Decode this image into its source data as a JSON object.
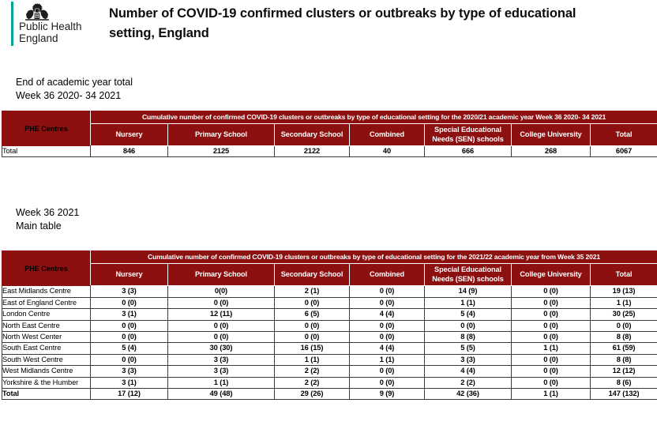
{
  "brand": {
    "name_line1": "Public Health",
    "name_line2": "England",
    "crest_icon": "royal-coat-of-arms-icon",
    "accent_color": "#00A499"
  },
  "page": {
    "title_line1": "Number of COVID-19 confirmed clusters or outbreaks by type of educational",
    "title_line2": "setting, England",
    "table_header_color": "#8C1010"
  },
  "section_one": {
    "caption_line1": "End of academic year total",
    "caption_line2": "Week 36 2020- 34 2021",
    "banner": "Cumulative number of confirmed COVID-19 clusters or outbreaks by type of educational setting for the 2020/21 academic year Week 36 2020- 34 2021",
    "row_header": "PHE Centres",
    "columns": [
      "Nursery",
      "Primary School",
      "Secondary School",
      "Combined",
      "Special Educational Needs (SEN) schools",
      "College University",
      "Total"
    ],
    "columns_display": [
      {
        "line1": "Nursery",
        "line2": ""
      },
      {
        "line1": "Primary School",
        "line2": ""
      },
      {
        "line1": "Secondary School",
        "line2": ""
      },
      {
        "line1": "Combined",
        "line2": ""
      },
      {
        "line1": "Special Educational",
        "line2": "Needs (SEN) schools"
      },
      {
        "line1": "College University",
        "line2": ""
      },
      {
        "line1": "Total",
        "line2": ""
      }
    ],
    "rows": [
      {
        "label": "Total",
        "values": [
          "846",
          "2125",
          "2122",
          "40",
          "666",
          "268",
          "6067"
        ]
      }
    ]
  },
  "section_two": {
    "caption_line1": "Week 36 2021",
    "caption_line2": "Main table",
    "banner": "Cumulative number of confirmed COVID-19 clusters or outbreaks by type of educational setting for the 2021/22 academic year from Week 35 2021",
    "row_header": "PHE Centres",
    "columns_display": [
      {
        "line1": "Nursery",
        "line2": ""
      },
      {
        "line1": "Primary School",
        "line2": ""
      },
      {
        "line1": "Secondary School",
        "line2": ""
      },
      {
        "line1": "Combined",
        "line2": ""
      },
      {
        "line1": "Special Educational",
        "line2": "Needs (SEN) schools"
      },
      {
        "line1": "College University",
        "line2": ""
      },
      {
        "line1": "Total",
        "line2": ""
      }
    ],
    "rows": [
      {
        "label": "East Midlands Centre",
        "values": [
          "3 (3)",
          "0(0)",
          "2 (1)",
          "0 (0)",
          "14 (9)",
          "0 (0)",
          "19 (13)"
        ]
      },
      {
        "label": "East of England Centre",
        "values": [
          "0 (0)",
          "0 (0)",
          "0 (0)",
          "0 (0)",
          "1 (1)",
          "0 (0)",
          "1 (1)"
        ]
      },
      {
        "label": "London Centre",
        "values": [
          "3 (1)",
          "12 (11)",
          "6 (5)",
          "4 (4)",
          "5 (4)",
          "0 (0)",
          "30 (25)"
        ]
      },
      {
        "label": "North East Centre",
        "values": [
          "0 (0)",
          "0 (0)",
          "0 (0)",
          "0 (0)",
          "0 (0)",
          "0 (0)",
          "0 (0)"
        ]
      },
      {
        "label": "North West Center",
        "values": [
          "0 (0)",
          "0 (0)",
          "0 (0)",
          "0 (0)",
          "8 (8)",
          "0 (0)",
          "8 (8)"
        ]
      },
      {
        "label": "South East Centre",
        "values": [
          "5 (4)",
          "30 (30)",
          "16 (15)",
          "4 (4)",
          "5 (5)",
          "1 (1)",
          "61 (59)"
        ]
      },
      {
        "label": "South West Centre",
        "values": [
          "0 (0)",
          "3 (3)",
          "1 (1)",
          "1 (1)",
          "3 (3)",
          "0 (0)",
          "8 (8)"
        ]
      },
      {
        "label": "West Midlands Centre",
        "values": [
          "3 (3)",
          "3 (3)",
          "2 (2)",
          "0 (0)",
          "4 (4)",
          "0 (0)",
          "12 (12)"
        ]
      },
      {
        "label": "Yorkshire & the Humber",
        "values": [
          "3 (1)",
          "1 (1)",
          "2 (2)",
          "0 (0)",
          "2 (2)",
          "0 (0)",
          "8 (6)"
        ]
      }
    ],
    "total_row": {
      "label": "Total",
      "values": [
        "17 (12)",
        "49 (48)",
        "29 (26)",
        "9 (9)",
        "42 (36)",
        "1 (1)",
        "147 (132)"
      ]
    }
  }
}
